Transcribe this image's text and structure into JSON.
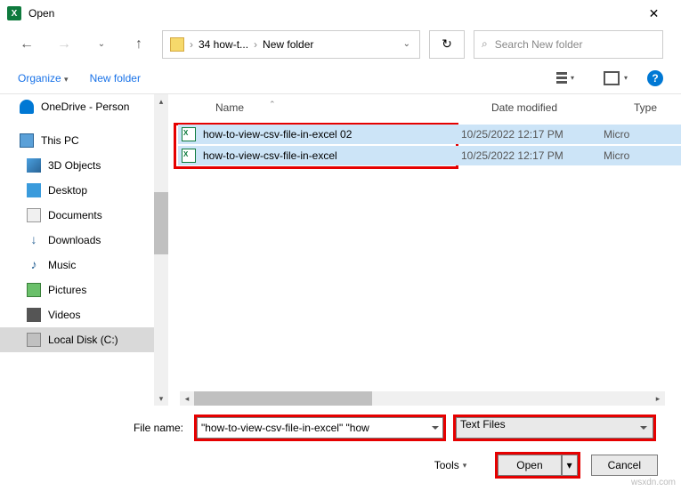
{
  "titlebar": {
    "title": "Open"
  },
  "address": {
    "crumb1": "34 how-t...",
    "crumb2": "New folder"
  },
  "search": {
    "placeholder": "Search New folder"
  },
  "toolbar": {
    "organize": "Organize",
    "newfolder": "New folder",
    "help": "?"
  },
  "sidebar": {
    "onedrive": "OneDrive - Person",
    "thispc": "This PC",
    "items": [
      {
        "label": "3D Objects"
      },
      {
        "label": "Desktop"
      },
      {
        "label": "Documents"
      },
      {
        "label": "Downloads"
      },
      {
        "label": "Music"
      },
      {
        "label": "Pictures"
      },
      {
        "label": "Videos"
      },
      {
        "label": "Local Disk (C:)"
      }
    ]
  },
  "columns": {
    "name": "Name",
    "date": "Date modified",
    "type": "Type"
  },
  "files": [
    {
      "name": "how-to-view-csv-file-in-excel 02",
      "date": "10/25/2022 12:17 PM",
      "type": "Micro"
    },
    {
      "name": "how-to-view-csv-file-in-excel",
      "date": "10/25/2022 12:17 PM",
      "type": "Micro"
    }
  ],
  "footer": {
    "fn_label": "File name:",
    "fn_value": "\"how-to-view-csv-file-in-excel\" \"how",
    "filter": "Text Files",
    "tools": "Tools",
    "open": "Open",
    "cancel": "Cancel"
  },
  "watermark": "wsxdn.com"
}
